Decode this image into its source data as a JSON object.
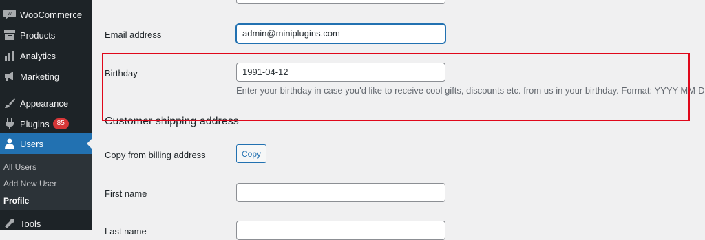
{
  "sidebar": {
    "items": [
      {
        "label": "WooCommerce",
        "icon": "woo-icon"
      },
      {
        "label": "Products",
        "icon": "archive-icon"
      },
      {
        "label": "Analytics",
        "icon": "bar-chart-icon"
      },
      {
        "label": "Marketing",
        "icon": "megaphone-icon"
      },
      {
        "label": "Appearance",
        "icon": "paintbrush-icon"
      },
      {
        "label": "Plugins",
        "icon": "plug-icon",
        "badge": "85"
      },
      {
        "label": "Users",
        "icon": "user-icon",
        "active": true
      },
      {
        "label": "Tools",
        "icon": "wrench-icon"
      }
    ],
    "submenu": [
      {
        "label": "All Users"
      },
      {
        "label": "Add New User"
      },
      {
        "label": "Profile",
        "current": true
      }
    ]
  },
  "form": {
    "email_label": "Email address",
    "email_value": "admin@miniplugins.com",
    "birthday_label": "Birthday",
    "birthday_value": "1991-04-12",
    "birthday_description": "Enter your birthday in case you'd like to receive cool gifts, discounts etc. from us in your birthday. Format: YYYY-MM-DD",
    "shipping_section_title": "Customer shipping address",
    "copy_label": "Copy from billing address",
    "copy_button": "Copy",
    "first_name_label": "First name",
    "first_name_value": "",
    "last_name_label": "Last name",
    "last_name_value": ""
  },
  "colors": {
    "sidebar_bg": "#1d2327",
    "active_bg": "#2271b1",
    "badge_bg": "#d63638",
    "highlight": "#e0081b"
  }
}
